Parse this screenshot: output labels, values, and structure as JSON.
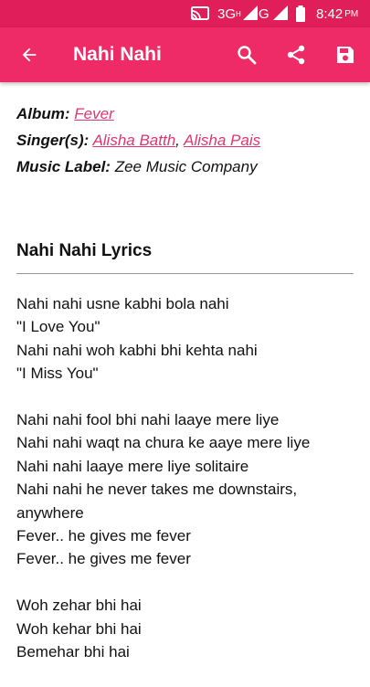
{
  "status_bar": {
    "network1": "3G",
    "network1_sup": "H",
    "network2": "G",
    "time": "8:42",
    "ampm": "PM",
    "cast_icon": "cast-icon",
    "signal_icon": "signal-icon",
    "battery_icon": "battery-icon"
  },
  "app_bar": {
    "title": "Nahi Nahi",
    "back_icon": "arrow-back-icon",
    "search_icon": "search-icon",
    "share_icon": "share-icon",
    "save_icon": "save-icon",
    "color": "#ef2b67"
  },
  "meta": {
    "album_label": "Album:",
    "album": "Fever",
    "singers_label": "Singer(s):",
    "singer1": "Alisha Batth",
    "separator": ",",
    "singer2": "Alisha Pais",
    "music_label_label": "Music Label:",
    "music_label": "Zee Music Company",
    "link_color": "#e0356f"
  },
  "lyrics": {
    "heading": "Nahi Nahi Lyrics",
    "stanzas": [
      [
        "Nahi nahi usne kabhi bola nahi",
        "\"I Love You\"",
        "Nahi nahi woh kabhi bhi kehta nahi",
        "\"I Miss You\""
      ],
      [
        "Nahi nahi fool bhi nahi laaye mere liye",
        "Nahi nahi waqt na chura ke aaye mere liye",
        "Nahi nahi laaye mere liye solitaire",
        "Nahi nahi he never takes me downstairs, anywhere",
        "Fever.. he gives me fever",
        "Fever.. he gives me fever"
      ],
      [
        "Woh zehar bhi hai",
        "Woh kehar bhi hai",
        "Bemehar bhi hai"
      ]
    ]
  }
}
